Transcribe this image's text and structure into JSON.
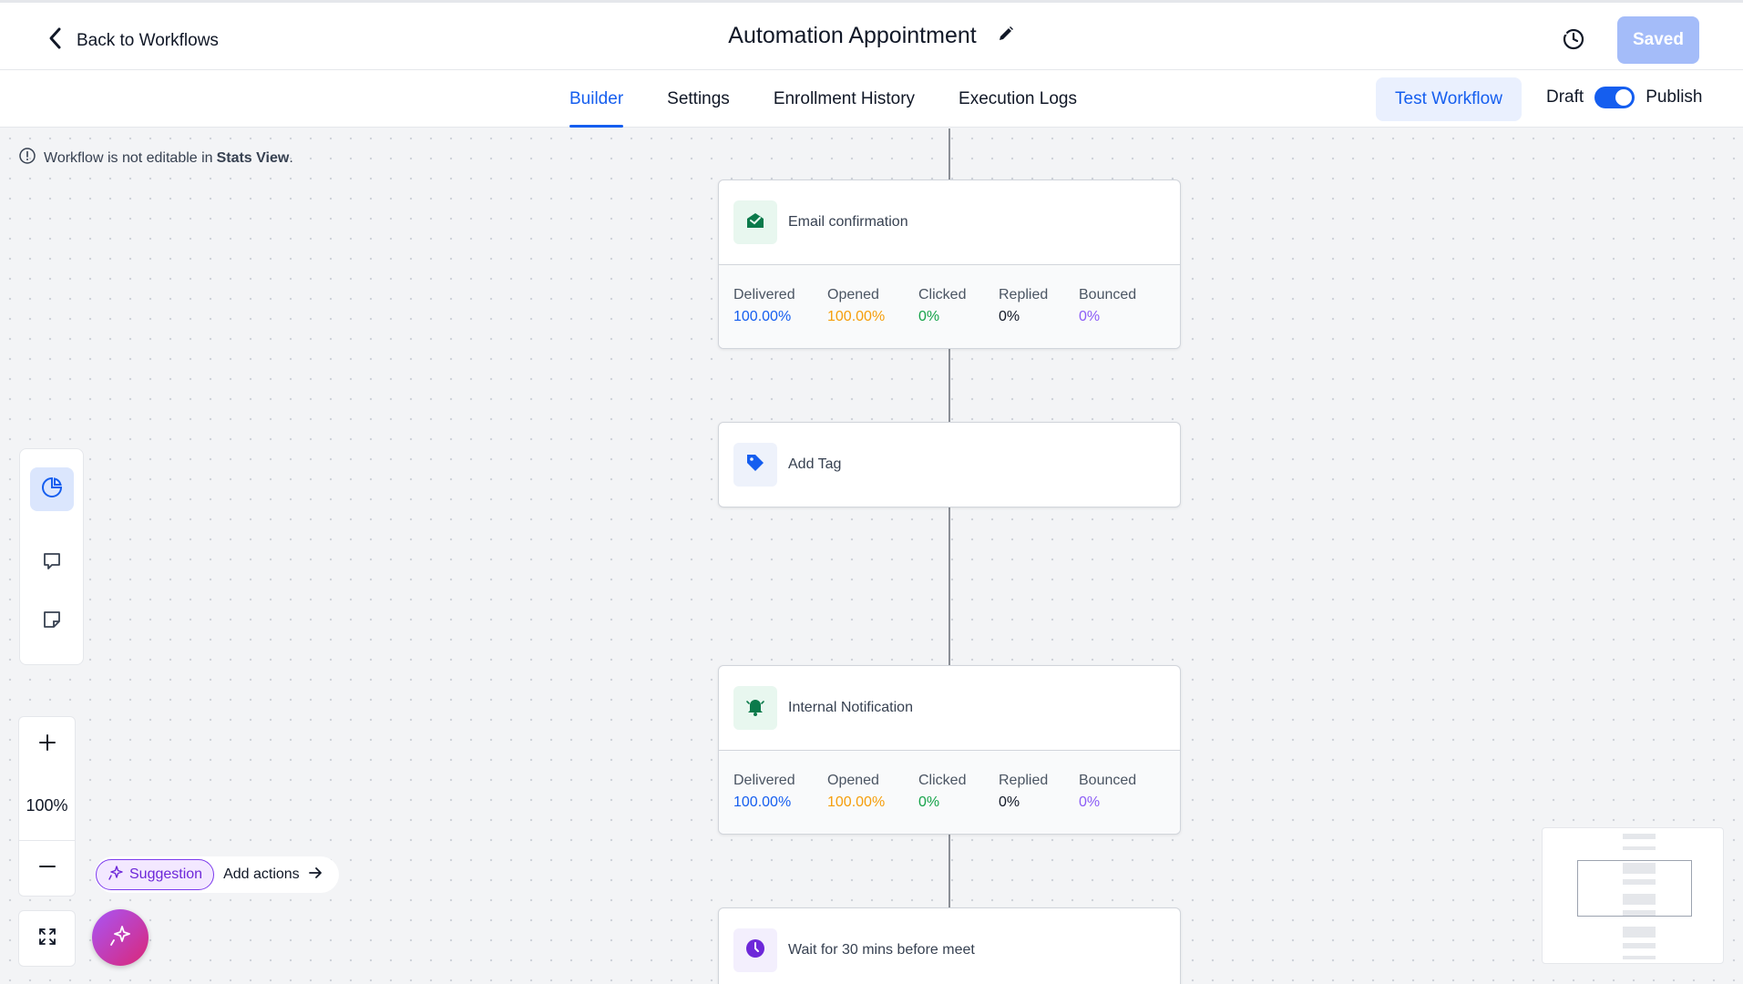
{
  "header": {
    "back_label": "Back to Workflows",
    "title": "Automation Appointment",
    "saved_label": "Saved"
  },
  "tabs": [
    {
      "label": "Builder",
      "active": true
    },
    {
      "label": "Settings",
      "active": false
    },
    {
      "label": "Enrollment History",
      "active": false
    },
    {
      "label": "Execution Logs",
      "active": false
    }
  ],
  "actions": {
    "test_label": "Test Workflow",
    "draft_label": "Draft",
    "publish_label": "Publish",
    "publish_enabled": true
  },
  "notice": {
    "prefix": "Workflow is not editable in",
    "emphasis": "Stats View",
    "suffix": "."
  },
  "nodes": [
    {
      "title": "Email confirmation",
      "icon": "mail-open-icon",
      "stats": [
        {
          "label": "Delivered",
          "value": "100.00%"
        },
        {
          "label": "Opened",
          "value": "100.00%"
        },
        {
          "label": "Clicked",
          "value": "0%"
        },
        {
          "label": "Replied",
          "value": "0%"
        },
        {
          "label": "Bounced",
          "value": "0%"
        }
      ]
    },
    {
      "title": "Add Tag",
      "icon": "tag-icon"
    },
    {
      "title": "Internal Notification",
      "icon": "bell-icon",
      "stats": [
        {
          "label": "Delivered",
          "value": "100.00%"
        },
        {
          "label": "Opened",
          "value": "100.00%"
        },
        {
          "label": "Clicked",
          "value": "0%"
        },
        {
          "label": "Replied",
          "value": "0%"
        },
        {
          "label": "Bounced",
          "value": "0%"
        }
      ]
    },
    {
      "title": "Wait for 30 mins before meet",
      "icon": "clock-icon"
    }
  ],
  "zoom": {
    "level": "100%"
  },
  "suggestion": {
    "pill_label": "Suggestion",
    "action_label": "Add actions"
  },
  "colors": {
    "accent": "#155eef",
    "delivered": "#155eef",
    "opened": "#f59e0b",
    "clicked": "#16a34a",
    "replied": "#111827",
    "bounced": "#8b5cf6"
  }
}
